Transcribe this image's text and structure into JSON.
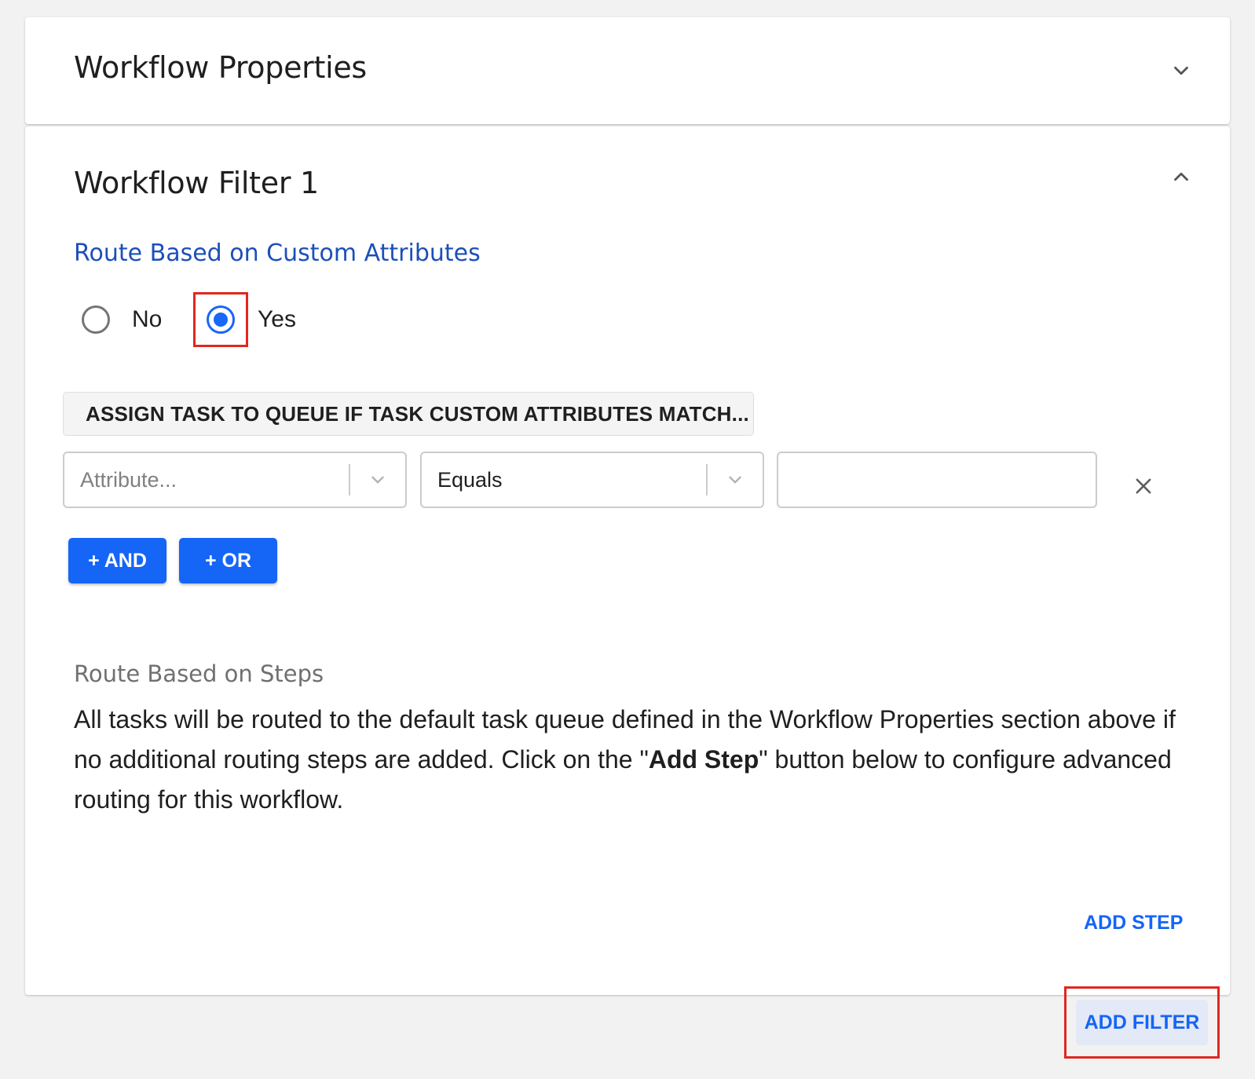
{
  "properties_panel": {
    "title": "Workflow Properties",
    "toggle_icon": "chevron-down-icon"
  },
  "filter_panel": {
    "title": "Workflow Filter 1",
    "toggle_icon": "chevron-up-icon",
    "custom_attributes": {
      "heading": "Route Based on Custom Attributes",
      "options": [
        {
          "label": "No",
          "selected": false
        },
        {
          "label": "Yes",
          "selected": true
        }
      ],
      "condition_header": "ASSIGN TASK TO QUEUE IF TASK CUSTOM ATTRIBUTES MATCH...",
      "attribute_select": {
        "placeholder": "Attribute..."
      },
      "operator_select": {
        "value": "Equals"
      },
      "value_input": {
        "value": ""
      },
      "remove_icon": "close-icon",
      "and_label": "+ AND",
      "or_label": "+ OR"
    },
    "steps": {
      "heading": "Route Based on Steps",
      "description_before": "All tasks will be routed to the default task queue defined in the Workflow Properties section above if no additional routing steps are added. Click on the \"",
      "description_bold": "Add Step",
      "description_after": "\" button below to configure advanced routing for this workflow.",
      "add_step_label": "ADD STEP"
    }
  },
  "footer": {
    "add_filter_label": "ADD FILTER"
  },
  "colors": {
    "accent": "#1565f6",
    "heading_blue": "#1c4fb8",
    "highlight": "#e0271f",
    "background": "#f2f2f3"
  }
}
